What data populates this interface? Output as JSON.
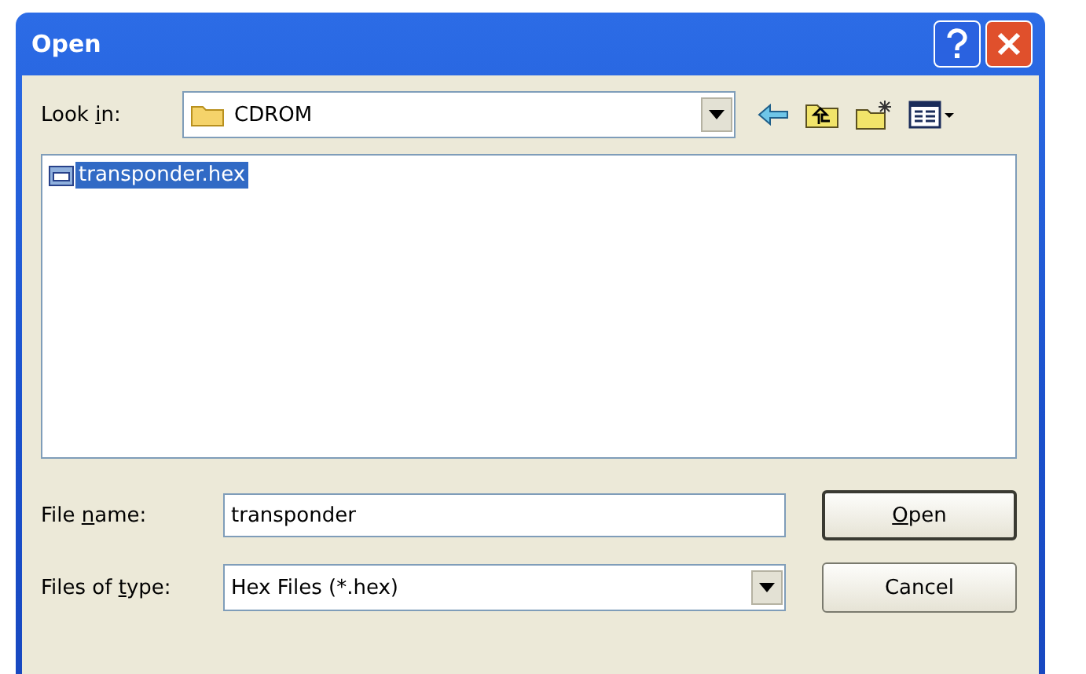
{
  "window": {
    "title": "Open"
  },
  "look_in": {
    "label": [
      {
        "text": "Look "
      },
      {
        "text": "i",
        "underlined": true
      },
      {
        "text": "n:"
      }
    ],
    "value": "CDROM"
  },
  "files": [
    {
      "name": "transponder.hex",
      "selected": true
    }
  ],
  "file_name": {
    "label": [
      {
        "text": "File "
      },
      {
        "text": "n",
        "underlined": true
      },
      {
        "text": "ame:"
      }
    ],
    "value": "transponder"
  },
  "file_type": {
    "label": [
      {
        "text": "Files of "
      },
      {
        "text": "t",
        "underlined": true
      },
      {
        "text": "ype:"
      }
    ],
    "value": "Hex Files (*.hex)"
  },
  "buttons": [
    {
      "label": [
        {
          "text": "O",
          "underlined": true
        },
        {
          "text": "pen"
        }
      ],
      "default": true
    },
    {
      "label": [
        {
          "text": "Cancel"
        }
      ],
      "default": false
    }
  ]
}
